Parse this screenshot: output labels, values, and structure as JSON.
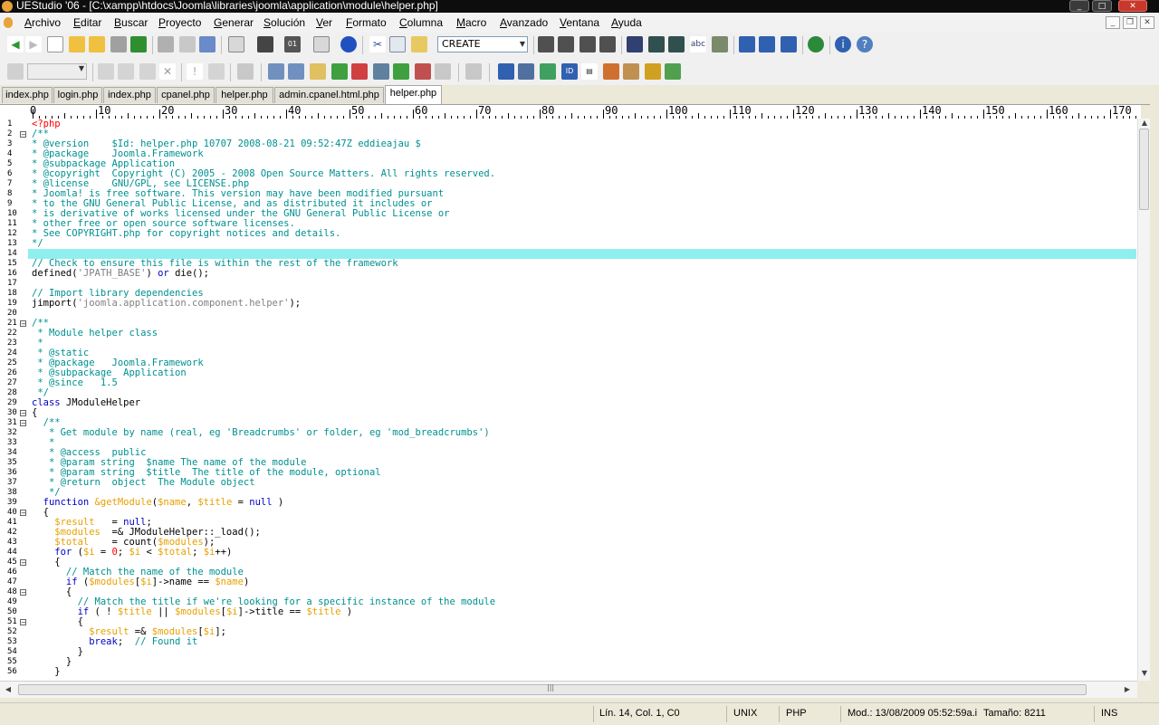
{
  "window": {
    "title": "UEStudio '06 - [C:\\xampp\\htdocs\\Joomla\\libraries\\joomla\\application\\module\\helper.php]",
    "controls": {
      "minimize": "_",
      "maximize": "□",
      "close": "✕"
    }
  },
  "menu": {
    "items": [
      "Archivo",
      "Editar",
      "Buscar",
      "Proyecto",
      "Generar",
      "Solución",
      "Ver",
      "Formato",
      "Columna",
      "Macro",
      "Avanzado",
      "Ventana",
      "Ayuda"
    ],
    "mdi_controls": {
      "minimize": "_",
      "restore": "❐",
      "close": "✕"
    }
  },
  "toolbar": {
    "combo_value": "CREATE",
    "icons_row1": [
      "back-icon",
      "forward-icon",
      "new-file-icon",
      "open-folder-icon",
      "open-folder-alt-icon",
      "save-icon",
      "save-all-icon",
      "print-icon",
      "print-preview-icon",
      "find-icon",
      "page-icon",
      "list-icon",
      "hex-icon",
      "document-icon",
      "help-web-icon",
      "cut-icon",
      "copy-icon",
      "paste-icon",
      "align-left-icon",
      "align-center-icon",
      "align-right-icon",
      "justify-icon",
      "binoculars-icon",
      "find-next-icon",
      "find-prev-icon",
      "spell-check-icon",
      "printer-icon",
      "split-horizontal-icon",
      "split-vertical-icon",
      "cascade-icon",
      "globe-icon",
      "info-icon",
      "help-icon"
    ],
    "icons_row2": [
      "bookmark-icon",
      "cut-disabled-icon",
      "copy-disabled-icon",
      "paste-disabled-icon",
      "delete-icon",
      "exclamation-icon",
      "flag-icon",
      "list-disabled-icon",
      "project-new-icon",
      "project-open-icon",
      "project-up-icon",
      "project-add-icon",
      "project-remove-icon",
      "project-settings-icon",
      "project-build-icon",
      "project-run-icon",
      "project-stop-icon",
      "monitor-icon",
      "grid-icon",
      "windows-icon",
      "check-icon",
      "id-icon",
      "checklist-icon",
      "tools-icon",
      "package-icon",
      "package-alt-icon",
      "settings-icon"
    ]
  },
  "tabs": [
    {
      "label": "index.php",
      "active": false
    },
    {
      "label": "login.php",
      "active": false
    },
    {
      "label": "index.php",
      "active": false
    },
    {
      "label": "cpanel.php",
      "active": false
    },
    {
      "label": "helper.php",
      "active": false
    },
    {
      "label": "admin.cpanel.html.php",
      "active": false
    },
    {
      "label": "helper.php",
      "active": true
    }
  ],
  "ruler": {
    "labels": [
      "0",
      "10",
      "20",
      "30",
      "40",
      "50",
      "60",
      "70",
      "80",
      "90",
      "100",
      "110",
      "120",
      "130",
      "140",
      "150",
      "160",
      "170"
    ]
  },
  "editor": {
    "highlighted_line": 14,
    "fold_lines": [
      2,
      21,
      30,
      31,
      40,
      45,
      48,
      51
    ],
    "lines": [
      [
        [
          "tg",
          "<?php"
        ]
      ],
      [
        [
          "cm",
          "/**"
        ]
      ],
      [
        [
          "cm",
          "* @version    $Id: helper.php 10707 2008-08-21 09:52:47Z eddieajau $"
        ]
      ],
      [
        [
          "cm",
          "* @package    Joomla.Framework"
        ]
      ],
      [
        [
          "cm",
          "* @subpackage Application"
        ]
      ],
      [
        [
          "cm",
          "* @copyright  Copyright (C) 2005 - 2008 Open Source Matters. All rights reserved."
        ]
      ],
      [
        [
          "cm",
          "* @license    GNU/GPL, see LICENSE.php"
        ]
      ],
      [
        [
          "cm",
          "* Joomla! is free software. This version may have been modified pursuant"
        ]
      ],
      [
        [
          "cm",
          "* to the GNU General Public License, and as distributed it includes or"
        ]
      ],
      [
        [
          "cm",
          "* is derivative of works licensed under the GNU General Public License or"
        ]
      ],
      [
        [
          "cm",
          "* other free or open source software licenses."
        ]
      ],
      [
        [
          "cm",
          "* See COPYRIGHT.php for copyright notices and details."
        ]
      ],
      [
        [
          "cm",
          "*/"
        ]
      ],
      [],
      [
        [
          "cm",
          "// Check to ensure this file is within the rest of the framework"
        ]
      ],
      [
        [
          "pl",
          "defined("
        ],
        [
          "st",
          "'JPATH_BASE'"
        ],
        [
          "pl",
          ") "
        ],
        [
          "kw",
          "or"
        ],
        [
          "pl",
          " die();"
        ]
      ],
      [],
      [
        [
          "cm",
          "// Import library dependencies"
        ]
      ],
      [
        [
          "pl",
          "jimport("
        ],
        [
          "st",
          "'joomla.application.component.helper'"
        ],
        [
          "pl",
          ");"
        ]
      ],
      [],
      [
        [
          "cm",
          "/**"
        ]
      ],
      [
        [
          "cm",
          " * Module helper class"
        ]
      ],
      [
        [
          "cm",
          " *"
        ]
      ],
      [
        [
          "cm",
          " * @static"
        ]
      ],
      [
        [
          "cm",
          " * @package   Joomla.Framework"
        ]
      ],
      [
        [
          "cm",
          " * @subpackage  Application"
        ]
      ],
      [
        [
          "cm",
          " * @since   1.5"
        ]
      ],
      [
        [
          "cm",
          " */"
        ]
      ],
      [
        [
          "kw",
          "class"
        ],
        [
          "pl",
          " JModuleHelper"
        ]
      ],
      [
        [
          "pl",
          "{"
        ]
      ],
      [
        [
          "cm",
          "  /**"
        ]
      ],
      [
        [
          "cm",
          "   * Get module by name (real, eg 'Breadcrumbs' or folder, eg 'mod_breadcrumbs')"
        ]
      ],
      [
        [
          "cm",
          "   *"
        ]
      ],
      [
        [
          "cm",
          "   * @access  public"
        ]
      ],
      [
        [
          "cm",
          "   * @param string  $name The name of the module"
        ]
      ],
      [
        [
          "cm",
          "   * @param string  $title  The title of the module, optional"
        ]
      ],
      [
        [
          "cm",
          "   * @return  object  The Module object"
        ]
      ],
      [
        [
          "cm",
          "   */"
        ]
      ],
      [
        [
          "kw",
          "  function "
        ],
        [
          "va",
          "&getModule"
        ],
        [
          "pl",
          "("
        ],
        [
          "va",
          "$name"
        ],
        [
          "pl",
          ", "
        ],
        [
          "va",
          "$title"
        ],
        [
          "pl",
          " = "
        ],
        [
          "kw",
          "null"
        ],
        [
          "pl",
          " )"
        ]
      ],
      [
        [
          "pl",
          "  {"
        ]
      ],
      [
        [
          "va",
          "    $result"
        ],
        [
          "pl",
          "   = "
        ],
        [
          "kw",
          "null"
        ],
        [
          "pl",
          ";"
        ]
      ],
      [
        [
          "va",
          "    $modules"
        ],
        [
          "pl",
          "  =& JModuleHelper::_load();"
        ]
      ],
      [
        [
          "va",
          "    $total"
        ],
        [
          "pl",
          "    = count("
        ],
        [
          "va",
          "$modules"
        ],
        [
          "pl",
          ");"
        ]
      ],
      [
        [
          "kw",
          "    for"
        ],
        [
          "pl",
          " ("
        ],
        [
          "va",
          "$i"
        ],
        [
          "pl",
          " = "
        ],
        [
          "nu",
          "0"
        ],
        [
          "pl",
          "; "
        ],
        [
          "va",
          "$i"
        ],
        [
          "pl",
          " < "
        ],
        [
          "va",
          "$total"
        ],
        [
          "pl",
          "; "
        ],
        [
          "va",
          "$i"
        ],
        [
          "pl",
          "++)"
        ]
      ],
      [
        [
          "pl",
          "    {"
        ]
      ],
      [
        [
          "cm",
          "      // Match the name of the module"
        ]
      ],
      [
        [
          "kw",
          "      if"
        ],
        [
          "pl",
          " ("
        ],
        [
          "va",
          "$modules"
        ],
        [
          "pl",
          "["
        ],
        [
          "va",
          "$i"
        ],
        [
          "pl",
          "]->name == "
        ],
        [
          "va",
          "$name"
        ],
        [
          "pl",
          ")"
        ]
      ],
      [
        [
          "pl",
          "      {"
        ]
      ],
      [
        [
          "cm",
          "        // Match the title if we're looking for a specific instance of the module"
        ]
      ],
      [
        [
          "kw",
          "        if"
        ],
        [
          "pl",
          " ( ! "
        ],
        [
          "va",
          "$title"
        ],
        [
          "pl",
          " || "
        ],
        [
          "va",
          "$modules"
        ],
        [
          "pl",
          "["
        ],
        [
          "va",
          "$i"
        ],
        [
          "pl",
          "]->title == "
        ],
        [
          "va",
          "$title"
        ],
        [
          "pl",
          " )"
        ]
      ],
      [
        [
          "pl",
          "        {"
        ]
      ],
      [
        [
          "va",
          "          $result"
        ],
        [
          "pl",
          " =& "
        ],
        [
          "va",
          "$modules"
        ],
        [
          "pl",
          "["
        ],
        [
          "va",
          "$i"
        ],
        [
          "pl",
          "];"
        ]
      ],
      [
        [
          "kw",
          "          break"
        ],
        [
          "pl",
          ";  "
        ],
        [
          "cm",
          "// Found it"
        ]
      ],
      [
        [
          "pl",
          "        }"
        ]
      ],
      [
        [
          "pl",
          "      }"
        ]
      ],
      [
        [
          "pl",
          "    }"
        ]
      ]
    ]
  },
  "statusbar": {
    "position": "Lín. 14, Col. 1, C0",
    "line_ending": "UNIX",
    "syntax": "PHP",
    "modified": "Mod.: 13/08/2009 05:52:59a.i",
    "size": "Tamaño: 8211",
    "mode": "INS"
  },
  "colors": {
    "comment": "#009090",
    "keyword": "#0000c8",
    "string": "#808080",
    "variable": "#e8a000",
    "tag": "#ff0000",
    "highlight": "#8fefef"
  }
}
